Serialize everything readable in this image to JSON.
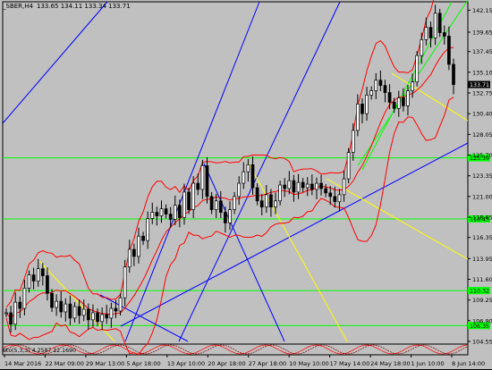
{
  "chart_data": {
    "type": "line",
    "symbol": "_SBER",
    "timeframe": "H4",
    "ohlc_text": "133.65 134.11 133.34 133.71",
    "current_price": "133.71",
    "ylim": [
      104.55,
      143.1
    ],
    "y_ticks": [
      "142.15",
      "139.65",
      "137.45",
      "135.10",
      "132.75",
      "130.40",
      "128.05",
      "125.70",
      "123.35",
      "121.00",
      "118.65",
      "116.35",
      "113.95",
      "111.60",
      "109.25",
      "106.90",
      "104.55"
    ],
    "x_ticks": [
      "14 Mar 2016",
      "22 Mar 09:00",
      "29 Mar 13:00",
      "5 Apr 18:00",
      "13 Apr 10:00",
      "20 Apr 18:00",
      "27 Apr 18:00",
      "10 May 10:00",
      "17 May 14:00",
      "24 May 18:00",
      "1 Jun 10:00",
      "8 Jun 14:00"
    ],
    "horizontal_levels": [
      {
        "value": 125.39,
        "label": "125.39"
      },
      {
        "value": 118.45,
        "label": "118.45"
      },
      {
        "value": 110.32,
        "label": "110.32"
      },
      {
        "value": 106.35,
        "label": "106.35"
      }
    ],
    "price_series": [
      107.8,
      106.5,
      109.0,
      108.3,
      110.6,
      112.1,
      111.4,
      112.8,
      112.0,
      110.0,
      108.4,
      109.1,
      107.9,
      108.8,
      107.2,
      108.5,
      107.5,
      108.2,
      107.0,
      107.8,
      106.8,
      107.6,
      107.2,
      108.3,
      108.0,
      109.5,
      113.0,
      115.0,
      114.2,
      116.5,
      116.0,
      118.5,
      119.2,
      118.8,
      119.6,
      119.0,
      118.4,
      120.0,
      118.6,
      121.5,
      119.5,
      122.5,
      121.8,
      124.5,
      121.0,
      119.5,
      120.5,
      119.2,
      118.0,
      119.5,
      121.0,
      122.5,
      123.8,
      124.6,
      122.0,
      120.5,
      119.8,
      121.2,
      119.8,
      120.5,
      122.3,
      121.9,
      122.8,
      121.5,
      122.6,
      122.0,
      122.4,
      121.8,
      122.5,
      121.9,
      121.4,
      121.0,
      120.4,
      121.2,
      123.0,
      126.0,
      128.5,
      131.5,
      130.4,
      132.5,
      133.0,
      134.2,
      133.6,
      132.8,
      131.7,
      131.0,
      132.2,
      131.3,
      133.0,
      134.0,
      137.0,
      138.8,
      140.2,
      139.0,
      141.8,
      139.6,
      139.2,
      136.0,
      133.71
    ],
    "indicator": {
      "label": "Sto(5,3,3) 4.2587 12.1690",
      "ylim": [
        0,
        100
      ]
    }
  },
  "colors": {
    "background": "#c0c0c0",
    "level_line": "#00ff00",
    "level_label_bg": "#00ff00",
    "bollinger": "#ff0000",
    "trend_blue": "#0000ff",
    "trend_yellow": "#ffff00",
    "trend_green": "#00ff00",
    "candle": "#000000",
    "current_price_bg": "#000000"
  }
}
